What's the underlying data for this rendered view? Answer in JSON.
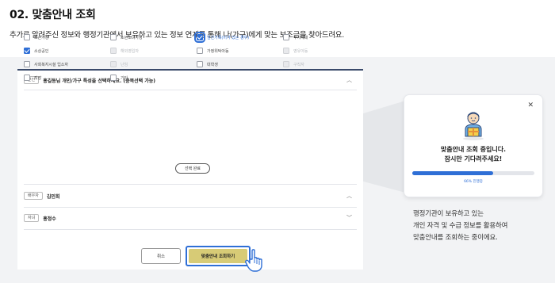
{
  "section": {
    "title": "02. 맞춤안내 조회",
    "description": "추가로 알려주신 정보와 행정기관에서 보유하고 있는 정보 연계를 통해 나(가구)에게 맞는 보조금을 찾아드려요."
  },
  "form": {
    "accordion_main": {
      "tag": "본인",
      "title": "홍길동님 개인/가구 특성을 선택하세요. (중복선택 가능)",
      "expanded": true
    },
    "options": [
      {
        "label": "조손가정",
        "checked": false,
        "disabled": false
      },
      {
        "label": "소년소녀가정",
        "checked": false,
        "disabled": false
      },
      {
        "label": "임신가족(이가 있는 경우)",
        "checked": true,
        "disabled": false
      },
      {
        "label": "부자세대",
        "checked": false,
        "disabled": false
      },
      {
        "label": "소상공인",
        "checked": true,
        "disabled": false
      },
      {
        "label": "해외영입자",
        "checked": false,
        "disabled": true
      },
      {
        "label": "가정위탁아동",
        "checked": false,
        "disabled": false
      },
      {
        "label": "영유아동",
        "checked": false,
        "disabled": true
      },
      {
        "label": "사회복지시설 입소자",
        "checked": false,
        "disabled": false
      },
      {
        "label": "난임",
        "checked": false,
        "disabled": true
      },
      {
        "label": "대학생",
        "checked": false,
        "disabled": false
      },
      {
        "label": "구직자",
        "checked": false,
        "disabled": true
      },
      {
        "label": "직장",
        "checked": false,
        "disabled": false
      },
      {
        "label": "기타",
        "checked": false,
        "disabled": false
      }
    ],
    "select_done_label": "선택 완료",
    "accordion_members": [
      {
        "tag": "배우자",
        "name": "김민희",
        "chevron": "up"
      },
      {
        "tag": "자녀",
        "name": "홍정수",
        "chevron": "down"
      }
    ],
    "cancel_label": "취소",
    "submit_label": "맞춤안내 조회하기"
  },
  "modal": {
    "message_line1": "맞춤안내 조회 중입니다.",
    "message_line2": "잠시만 기다려주세요!",
    "progress_percent": 66,
    "progress_text": "66% 진행중",
    "close_icon": "close-icon",
    "illustration": "person-with-gift-box"
  },
  "caption": {
    "lines": [
      "행정기관이 보유하고 있는",
      "개인 자격 및 수급 정보를 활용하여",
      "맞춤안내를 조회하는 중이에요."
    ]
  },
  "colors": {
    "accent": "#2f6fd6",
    "submit_bg": "#d7cb76",
    "panel_bg": "#f2f3f5"
  }
}
